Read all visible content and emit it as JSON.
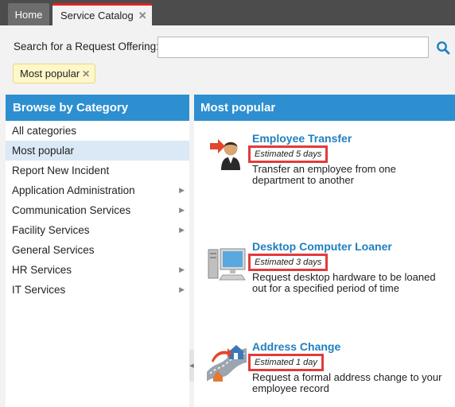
{
  "tabs": {
    "home_label": "Home",
    "catalog_label": "Service Catalog",
    "close_glyph": "✕"
  },
  "search": {
    "label": "Search for a Request Offering:",
    "value": "",
    "placeholder": ""
  },
  "filter_chip": {
    "label": "Most popular",
    "close_glyph": "✕"
  },
  "sidebar": {
    "header": "Browse by Category",
    "items": [
      {
        "label": "All categories",
        "has_submenu": false
      },
      {
        "label": "Most popular",
        "has_submenu": false,
        "selected": true
      },
      {
        "label": "Report New Incident",
        "has_submenu": false
      },
      {
        "label": "Application Administration",
        "has_submenu": true
      },
      {
        "label": "Communication Services",
        "has_submenu": true
      },
      {
        "label": "Facility Services",
        "has_submenu": true
      },
      {
        "label": "General Services",
        "has_submenu": false
      },
      {
        "label": "HR Services",
        "has_submenu": true
      },
      {
        "label": "IT Services",
        "has_submenu": true
      }
    ],
    "arrow_glyph": "▶"
  },
  "main": {
    "header": "Most popular",
    "offerings": [
      {
        "title": "Employee Transfer",
        "estimate": "Estimated 5 days",
        "description": "Transfer an employee from one department to another",
        "icon": "employee-transfer-icon"
      },
      {
        "title": "Desktop Computer Loaner",
        "estimate": "Estimated 3 days",
        "description": "Request desktop hardware to be loaned out for a specified period of time",
        "icon": "desktop-computer-icon"
      },
      {
        "title": "Address Change",
        "estimate": "Estimated 1 day",
        "description": "Request a formal address change to your employee record",
        "icon": "address-change-icon"
      }
    ]
  },
  "colors": {
    "accent": "#2d8fd0",
    "title_link": "#1f7fc0",
    "highlight_box": "#e23b3b",
    "tab_active_border": "#e02020",
    "chip_bg": "#fff7c8"
  }
}
